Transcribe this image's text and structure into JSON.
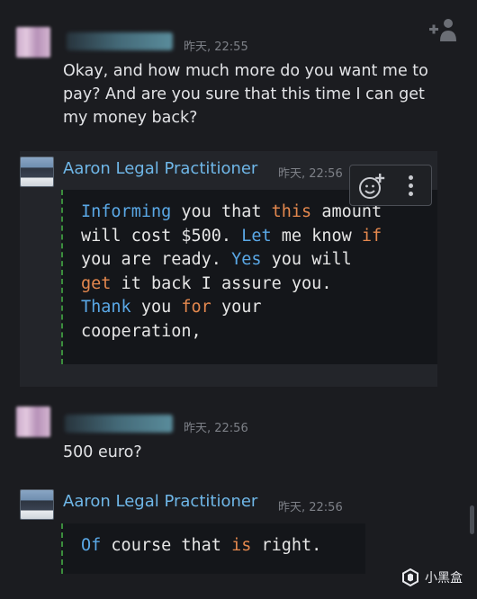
{
  "messages": [
    {
      "sender": "",
      "time": "昨天, 22:55",
      "text": "Okay, and how much more do you want me to pay? And are you sure that this time I can get my money back?"
    },
    {
      "sender": "Aaron Legal Practitioner",
      "time": "昨天, 22:56",
      "code_tokens": [
        [
          {
            "t": "Informing",
            "c": "blue"
          },
          {
            "t": " you that ",
            "c": ""
          },
          {
            "t": "this",
            "c": "orange"
          },
          {
            "t": " amount",
            "c": ""
          }
        ],
        [
          {
            "t": "will cost $500. ",
            "c": ""
          },
          {
            "t": "Let",
            "c": "blue"
          },
          {
            "t": " me know ",
            "c": ""
          },
          {
            "t": "if",
            "c": "orange"
          }
        ],
        [
          {
            "t": "you are ready. ",
            "c": ""
          },
          {
            "t": "Yes",
            "c": "blue"
          },
          {
            "t": " you will",
            "c": ""
          }
        ],
        [
          {
            "t": "get",
            "c": "orange"
          },
          {
            "t": " it back I assure you.",
            "c": ""
          }
        ],
        [
          {
            "t": "Thank",
            "c": "blue"
          },
          {
            "t": " you ",
            "c": ""
          },
          {
            "t": "for",
            "c": "orange"
          },
          {
            "t": " your",
            "c": ""
          }
        ],
        [
          {
            "t": "cooperation,",
            "c": ""
          }
        ]
      ]
    },
    {
      "sender": "",
      "time": "昨天, 22:56",
      "text": "500 euro?"
    },
    {
      "sender": "Aaron Legal Practitioner",
      "time": "昨天, 22:56",
      "code_tokens": [
        [
          {
            "t": "Of",
            "c": "blue"
          },
          {
            "t": " course that ",
            "c": ""
          },
          {
            "t": "is",
            "c": "orange"
          },
          {
            "t": " right.",
            "c": ""
          }
        ]
      ]
    }
  ],
  "watermark": "小黑盒",
  "colors": {
    "background": "#1b1c20",
    "sender_name": "#6fb7e8",
    "keyword_blue": "#5aa8e6",
    "keyword_orange": "#e4884e",
    "code_border": "#3b8d3c"
  },
  "icons": [
    "add-friend-icon",
    "add-reaction-icon",
    "more-options-icon",
    "watermark-logo-icon"
  ]
}
